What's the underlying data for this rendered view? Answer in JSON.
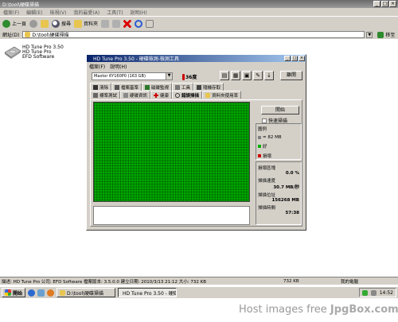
{
  "window": {
    "title": "D:\\tool\\硬碟掃描"
  },
  "menu": [
    "檔案(F)",
    "編輯(E)",
    "檢視(V)",
    "我的最愛(A)",
    "工具(T)",
    "說明(H)"
  ],
  "toolbar": {
    "back": "上一頁",
    "search": "搜尋",
    "folders": "資料夾"
  },
  "address": {
    "label": "網址(D)",
    "value": "D:\\tool\\硬碟掃描",
    "go": "移至"
  },
  "desktop_item": {
    "lines": [
      "HD Tune Pro 3.50",
      "HD Tune Pro",
      "EFD Software"
    ]
  },
  "hdtune": {
    "title": "HD Tune Pro 3.50 - 硬碟檢測-檢測工具",
    "menu": [
      "檔案(F)",
      "說明(H)"
    ],
    "drive": "Maxtor 6Y160P0 (163 GB)",
    "temperature": "36度",
    "exit": "離開",
    "tabs_row1": [
      "清除",
      "檔案基準",
      "磁碟監視",
      "工具",
      "隨機存取"
    ],
    "tabs_row2": [
      "標準測試",
      "硬碟資訊",
      "健康",
      "錯誤掃描",
      "資料夾使用率"
    ],
    "active_tab": "錯誤掃描",
    "start": "開始",
    "quick_scan": "快速掃描",
    "legend_title": "圖例",
    "legend": [
      {
        "label": "= 82 MB",
        "color": "#808080"
      },
      {
        "label": "好",
        "color": "#00b000"
      },
      {
        "label": "損壞",
        "color": "#cc0000"
      }
    ],
    "stats": [
      {
        "label": "損壞區塊",
        "value": "0.0 %"
      },
      {
        "label": "掃描速度",
        "value": "30.7 MB/秒"
      },
      {
        "label": "掃描位址",
        "value": "156268 MB"
      },
      {
        "label": "掃描時間",
        "value": "57:38"
      }
    ]
  },
  "statusbar": {
    "text": "描述: HD Tune Pro 公司: EFD Software 檔案版本: 3.5.0.0 建立日期: 2010/3/13 21:12 大小: 732 KB",
    "size": "732 KB",
    "zone": "我的電腦"
  },
  "taskbar": {
    "start": "開始",
    "tasks": [
      "D:\\tool\\硬碟掃描",
      "HD Tune Pro 3.50 - 硬碟..."
    ],
    "clock": "14:52"
  },
  "watermark": {
    "prefix": "Host images free ",
    "brand": "JpgBox.com"
  }
}
